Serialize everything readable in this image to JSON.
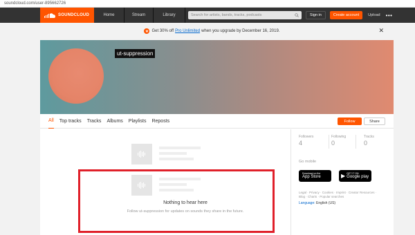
{
  "browser": {
    "url": "soundcloud.com/user-895662726"
  },
  "nav": {
    "logo_text": "SOUNDCLOUD",
    "home": "Home",
    "stream": "Stream",
    "library": "Library",
    "search_placeholder": "Search for artists, bands, tracks, podcasts",
    "sign_in": "Sign in",
    "create_account": "Create account",
    "upload": "Upload",
    "more": "•••"
  },
  "promo": {
    "badge": "★",
    "before": "Get 30% off",
    "link": "Pro Unlimited",
    "after": "when you upgrade by December 16, 2019."
  },
  "profile": {
    "username": "ut-suppression"
  },
  "tabs": [
    {
      "label": "All",
      "active": true
    },
    {
      "label": "Top tracks"
    },
    {
      "label": "Tracks"
    },
    {
      "label": "Albums"
    },
    {
      "label": "Playlists"
    },
    {
      "label": "Reposts"
    }
  ],
  "actions": {
    "follow": "Follow",
    "share": "Share"
  },
  "empty": {
    "title": "Nothing to hear here",
    "subtitle": "Follow ut-suppression for updates on sounds they share in the future."
  },
  "stats": [
    {
      "label": "Followers",
      "value": "4"
    },
    {
      "label": "Following",
      "value": "0"
    },
    {
      "label": "Tracks",
      "value": "0"
    }
  ],
  "mobile": {
    "heading": "Go mobile",
    "appstore_small": "Download on the",
    "appstore_big": "App Store",
    "googleplay_small": "GET IT ON",
    "googleplay_big": "Google play"
  },
  "footer": {
    "links": "Legal · Privacy · Cookies · Imprint · Creator Resources · Blog · Charts · Popular searches",
    "language_label": "Language:",
    "language_value": "English (US)"
  },
  "colors": {
    "accent": "#ff5500",
    "highlight_box": "#e0202a"
  }
}
